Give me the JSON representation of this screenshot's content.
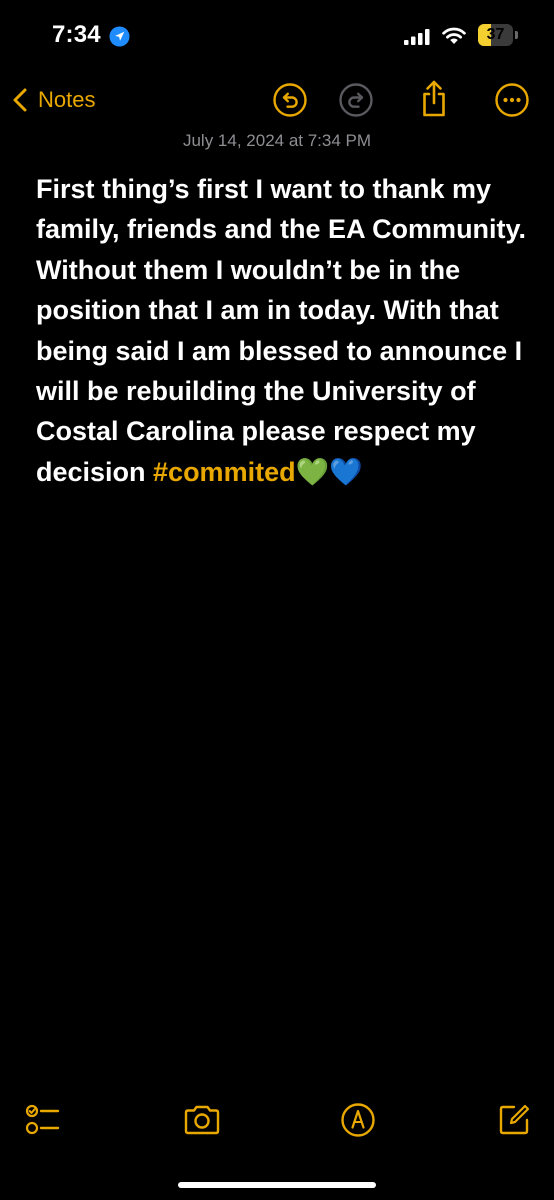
{
  "status_bar": {
    "time": "7:34",
    "location_icon": "location-arrow-icon",
    "battery_level": "37",
    "battery_fraction": 0.37,
    "battery_color": "#f3d02f"
  },
  "nav": {
    "back_label": "Notes",
    "icons": [
      "chevron-left-icon",
      "undo-icon",
      "redo-icon",
      "share-icon",
      "more-icon"
    ],
    "accent_color": "#e9a800"
  },
  "note": {
    "date": "July 14, 2024 at 7:34 PM",
    "body": "First thing’s first I want to thank my family, friends and the EA Community. Without them I wouldn’t be in the position that I am in today. With that being said I am blessed to announce I will be rebuilding the University of Costal Carolina please respect my decision ",
    "hashtag": "#commited",
    "emojis": [
      "💚",
      "💙"
    ]
  },
  "toolbar": {
    "icons": [
      "checklist-icon",
      "camera-icon",
      "markup-icon",
      "compose-icon"
    ]
  }
}
